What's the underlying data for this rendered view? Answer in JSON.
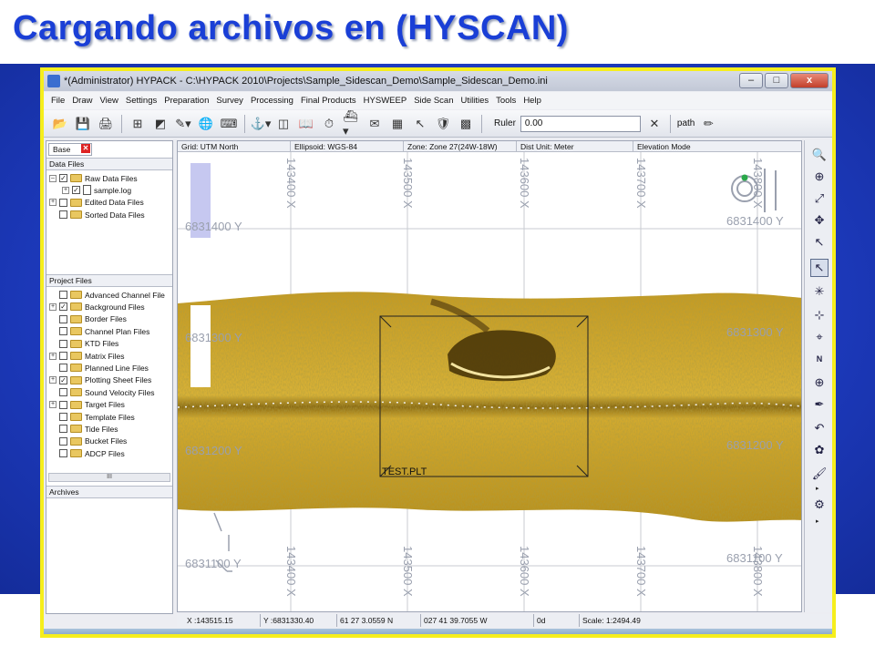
{
  "slide": {
    "title": "Cargando archivos en (HYSCAN)"
  },
  "window": {
    "title": "*(Administrator) HYPACK - C:\\HYPACK 2010\\Projects\\Sample_Sidescan_Demo\\Sample_Sidescan_Demo.ini",
    "buttons": {
      "minimize": "–",
      "maximize": "□",
      "close": "x"
    }
  },
  "menu": [
    "File",
    "Draw",
    "View",
    "Settings",
    "Preparation",
    "Survey",
    "Processing",
    "Final Products",
    "HYSWEEP",
    "Side Scan",
    "Utilities",
    "Tools",
    "Help"
  ],
  "toolbar": {
    "icons": [
      "open-folder-icon",
      "save-icon",
      "print-icon",
      "chart-icon",
      "color-map-icon",
      "draw-tool-icon",
      "globe-icon",
      "keyboard-icon",
      "survey-icon",
      "layers-icon",
      "book-icon",
      "clock-icon",
      "boat-icon",
      "message-icon",
      "calculator-icon",
      "cursor-icon",
      "shield-icon",
      "matrix-icon"
    ],
    "ruler_label": "Ruler",
    "ruler_value": "0.00",
    "path_label": "path"
  },
  "left_panel": {
    "tab_label": "Base",
    "data_files_header": "Data Files",
    "data_files": [
      {
        "label": "Raw Data Files",
        "expander": "–",
        "checked": true,
        "indent": 0,
        "icon": "folder"
      },
      {
        "label": "sample.log",
        "expander": "+",
        "checked": true,
        "indent": 1,
        "icon": "file"
      },
      {
        "label": "Edited Data Files",
        "expander": "+",
        "checked": false,
        "indent": 0,
        "icon": "folder"
      },
      {
        "label": "Sorted Data Files",
        "expander": "",
        "checked": false,
        "indent": 0,
        "icon": "folder"
      }
    ],
    "project_files_header": "Project Files",
    "project_files": [
      {
        "label": "Advanced Channel File",
        "expander": "",
        "checked": false
      },
      {
        "label": "Background Files",
        "expander": "+",
        "checked": true
      },
      {
        "label": "Border Files",
        "expander": "",
        "checked": false
      },
      {
        "label": "Channel Plan Files",
        "expander": "",
        "checked": false
      },
      {
        "label": "KTD Files",
        "expander": "",
        "checked": false
      },
      {
        "label": "Matrix Files",
        "expander": "+",
        "checked": false
      },
      {
        "label": "Planned Line Files",
        "expander": "",
        "checked": false
      },
      {
        "label": "Plotting Sheet Files",
        "expander": "+",
        "checked": true
      },
      {
        "label": "Sound Velocity Files",
        "expander": "",
        "checked": false
      },
      {
        "label": "Target Files",
        "expander": "+",
        "checked": false
      },
      {
        "label": "Template Files",
        "expander": "",
        "checked": false
      },
      {
        "label": "Tide Files",
        "expander": "",
        "checked": false
      },
      {
        "label": "Bucket Files",
        "expander": "",
        "checked": false
      },
      {
        "label": "ADCP Files",
        "expander": "",
        "checked": false
      }
    ],
    "scroll_grip": "III",
    "archives_header": "Archives"
  },
  "map": {
    "header": {
      "grid": "Grid: UTM North",
      "ellipsoid": "Ellipsoid: WGS-84",
      "zone": "Zone: Zone 27(24W-18W)",
      "dist_unit": "Dist Unit: Meter",
      "elevation": "Elevation Mode"
    },
    "x_labels": [
      "143400 X",
      "143500 X",
      "143600 X",
      "143700 X",
      "143800 X"
    ],
    "y_labels": [
      "6831400 Y",
      "6831300 Y",
      "6831200 Y",
      "6831100 Y"
    ],
    "plot_label": "TEST.PLT",
    "north_arrow": "N"
  },
  "right_toolbar": {
    "icons": [
      "zoom-in-icon",
      "zoom-window-icon",
      "zoom-extents-icon",
      "zoom-pan-icon",
      "pointer-icon",
      "select-icon",
      "multi-select-icon",
      "crosshair-icon",
      "target-icon",
      "north-icon",
      "target-plus-icon",
      "pen-icon",
      "undo-icon",
      "color-wheel-icon",
      "brush-icon",
      "settings-icon"
    ]
  },
  "status": {
    "x": "X :143515.15",
    "y": "Y :6831330.40",
    "lat": "61 27 3.0559 N",
    "lon": "027 41 39.7055 W",
    "heading": "0d",
    "scale": "Scale: 1:2494.49"
  },
  "colors": {
    "title": "#1a3fd6",
    "frame": "#f6ee1c",
    "sonar": "#b58e1e",
    "background_band": "#1e3cc2"
  }
}
